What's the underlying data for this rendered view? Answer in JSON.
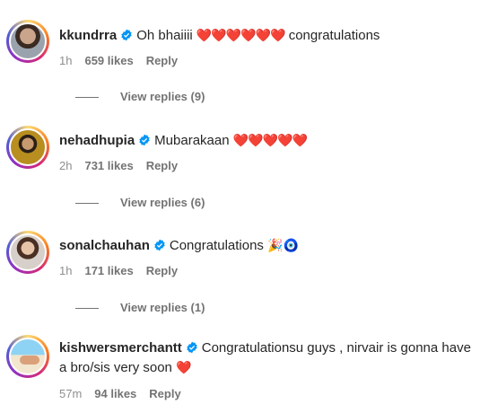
{
  "comments": [
    {
      "username": "kkundrra",
      "text": "Oh bhaiiii",
      "emoji": "❤️❤️❤️❤️❤️❤️",
      "text_after": "congratulations",
      "time": "1h",
      "likes": "659 likes",
      "reply": "Reply",
      "view_replies": "View replies (9)"
    },
    {
      "username": "nehadhupia",
      "text": "Mubarakaan",
      "emoji": "❤️❤️❤️❤️❤️",
      "time": "2h",
      "likes": "731 likes",
      "reply": "Reply",
      "view_replies": "View replies (6)"
    },
    {
      "username": "sonalchauhan",
      "text": "Congratulations",
      "emoji": "🎉🧿",
      "time": "1h",
      "likes": "171 likes",
      "reply": "Reply",
      "view_replies": "View replies (1)"
    },
    {
      "username": "kishwersmerchantt",
      "text": "Congratulationsu guys , nirvair is gonna have a bro/sis very soon",
      "emoji": "❤️",
      "time": "57m",
      "likes": "94 likes",
      "reply": "Reply"
    }
  ],
  "icons": {
    "verified": "verified-badge-icon",
    "verified_color": "#0095f6"
  }
}
